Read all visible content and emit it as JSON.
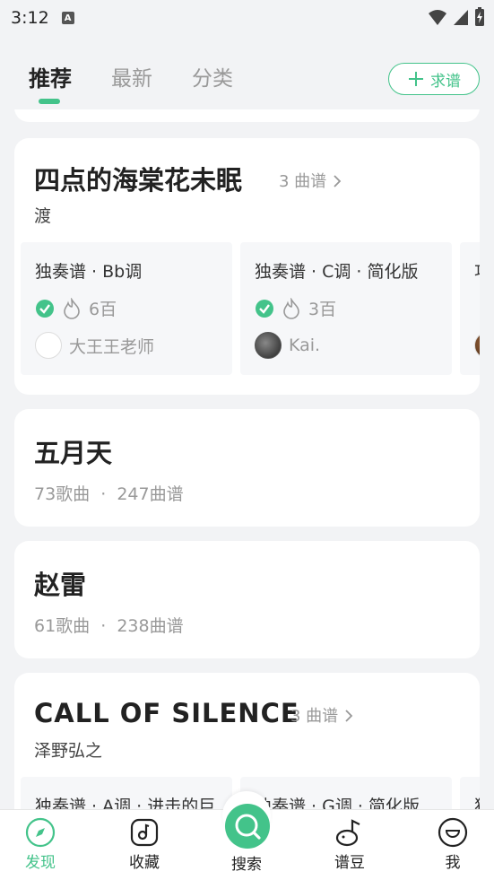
{
  "status": {
    "time": "3:12",
    "a_icon": "A"
  },
  "tabs": [
    {
      "label": "推荐",
      "active": true
    },
    {
      "label": "最新",
      "active": false
    },
    {
      "label": "分类",
      "active": false
    }
  ],
  "request_button": {
    "label": "求谱"
  },
  "colors": {
    "accent": "#43c38a",
    "verified": "#43c38a"
  },
  "cards": {
    "haitang": {
      "title": "四点的海棠花未眠",
      "count": "3 曲谱",
      "artist": "渡",
      "scores": [
        {
          "title": "独奏谱 · Bb调",
          "heat": "6百",
          "author": "大王王老师"
        },
        {
          "title": "独奏谱 · C调 · 简化版",
          "heat": "3百",
          "author": "Kai."
        }
      ],
      "third_title_fragment": "功"
    },
    "wuyuetian": {
      "title": "五月天",
      "songs": "73歌曲",
      "dot": "·",
      "scores": "247曲谱"
    },
    "zhaolei": {
      "title": "赵雷",
      "songs": "61歌曲",
      "dot": "·",
      "scores": "238曲谱"
    },
    "silence": {
      "title": "CALL OF SILENCE",
      "count": "3 曲谱",
      "artist": "泽野弘之",
      "scores": [
        {
          "title": "独奏谱 · A调 · 进击的巨"
        },
        {
          "title": "独奏谱 · G调 · 简化版"
        }
      ],
      "third_title_fragment": "独"
    }
  },
  "bottom_nav": {
    "discover": "发现",
    "favorites": "收藏",
    "search": "搜索",
    "beans": "谱豆",
    "me": "我"
  }
}
